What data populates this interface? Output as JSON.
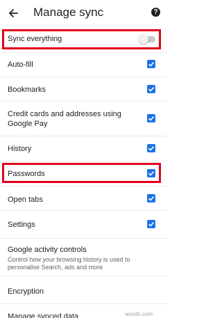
{
  "header": {
    "back_icon": "arrow-left-icon",
    "title": "Manage sync",
    "help_icon": "help-circle-icon",
    "help_glyph": "?"
  },
  "sync_everything": {
    "label": "Sync everything",
    "enabled": false
  },
  "items": [
    {
      "label": "Auto-fill",
      "checked": true
    },
    {
      "label": "Bookmarks",
      "checked": true
    },
    {
      "label": "Credit cards and addresses using",
      "label_line2": "Google Pay",
      "checked": true
    },
    {
      "label": "History",
      "checked": true
    },
    {
      "label": "Passwords",
      "checked": true
    },
    {
      "label": "Open tabs",
      "checked": true
    },
    {
      "label": "Settings",
      "checked": true
    }
  ],
  "activity_controls": {
    "label": "Google activity controls",
    "description_line1": "Control how your browsing history is used to",
    "description_line2": "personalise Search, ads and more"
  },
  "encryption": {
    "label": "Encryption"
  },
  "manage_synced_data": {
    "label": "Manage synced data"
  },
  "watermark": "wsxdn.com",
  "colors": {
    "accent": "#1a73e8",
    "highlight": "#e0001b",
    "separator": "#e8eaed",
    "text": "#202124"
  }
}
